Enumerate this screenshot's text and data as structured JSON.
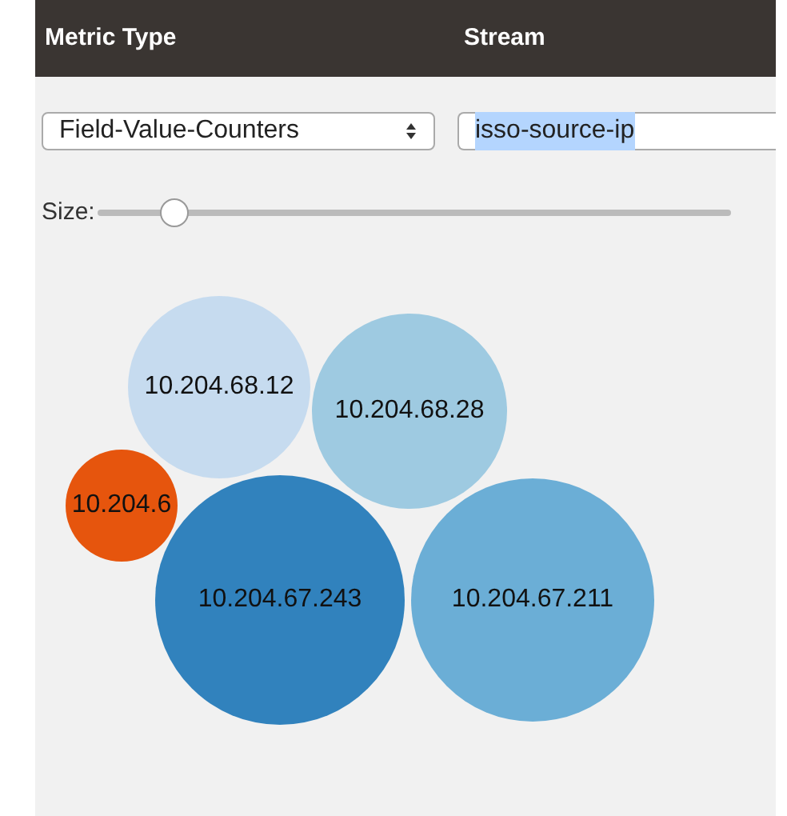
{
  "header": {
    "columns": [
      "Metric Type",
      "Stream"
    ]
  },
  "metric_select": {
    "value": "Field-Value-Counters"
  },
  "stream_field": {
    "value": "isso-source-ip",
    "highlighted": true
  },
  "size_slider": {
    "label": "Size:",
    "level": 0.12
  },
  "bubbles": [
    {
      "label": "10.204.68.12",
      "color": "#c6dbef"
    },
    {
      "label": "10.204.68.28",
      "color": "#9ecae1"
    },
    {
      "label": "10.204.6",
      "color": "#e6550d"
    },
    {
      "label": "10.204.67.243",
      "color": "#3182bd"
    },
    {
      "label": "10.204.67.211",
      "color": "#6baed6"
    }
  ]
}
